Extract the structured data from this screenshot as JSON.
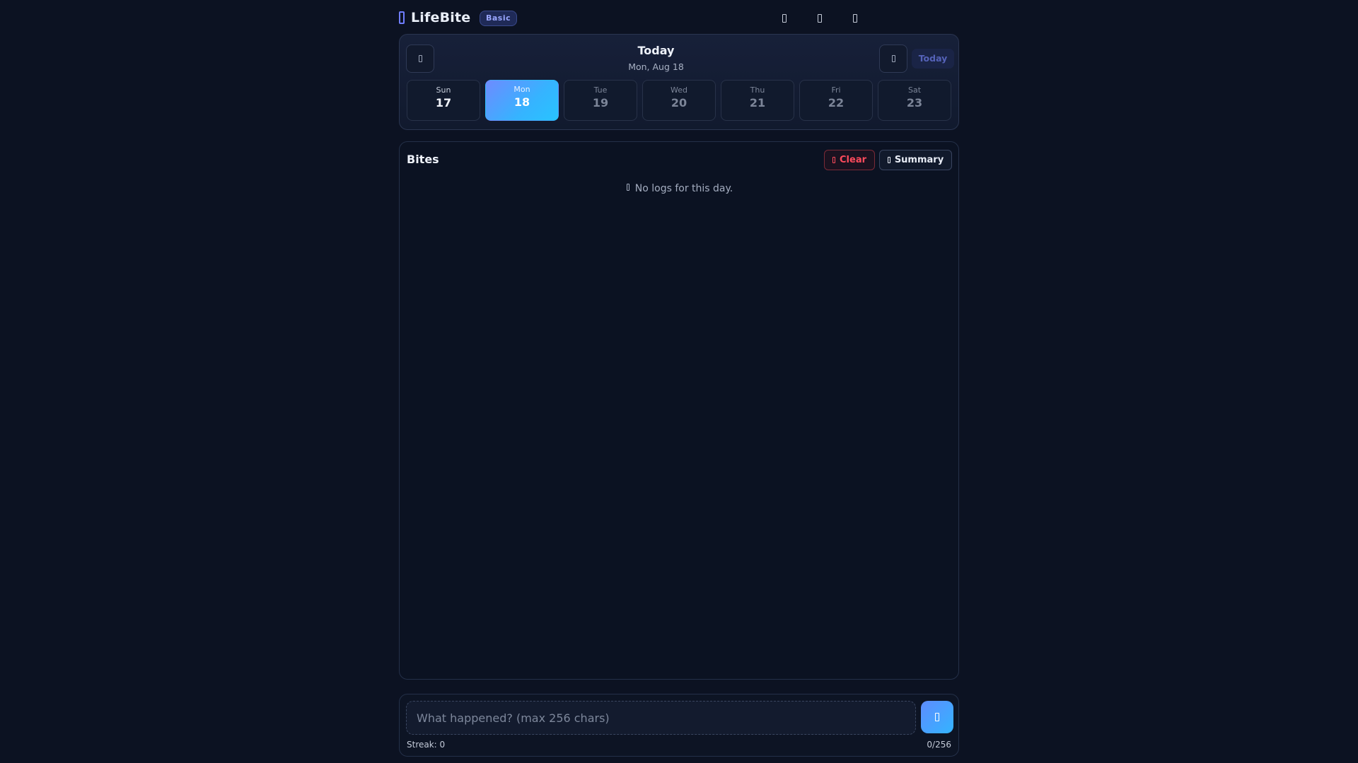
{
  "header": {
    "logo_icon": "book-icon",
    "app_name": "LifeBite",
    "plan_badge": "Basic",
    "actions": [
      {
        "icon": "stats-icon"
      },
      {
        "icon": "theme-icon"
      },
      {
        "icon": "settings-icon"
      }
    ]
  },
  "date_nav": {
    "title": "Today",
    "subtitle": "Mon, Aug 18",
    "prev_icon": "chevron-left-icon",
    "next_icon": "chevron-right-icon",
    "today_label": "Today",
    "week": [
      {
        "day": "Sun",
        "date": "17",
        "state": "past"
      },
      {
        "day": "Mon",
        "date": "18",
        "state": "active"
      },
      {
        "day": "Tue",
        "date": "19",
        "state": "future"
      },
      {
        "day": "Wed",
        "date": "20",
        "state": "future"
      },
      {
        "day": "Thu",
        "date": "21",
        "state": "future"
      },
      {
        "day": "Fri",
        "date": "22",
        "state": "future"
      },
      {
        "day": "Sat",
        "date": "23",
        "state": "future"
      }
    ]
  },
  "bites": {
    "title": "Bites",
    "clear_label": "Clear",
    "clear_icon": "trash-icon",
    "summary_label": "Summary",
    "summary_icon": "document-icon",
    "empty_icon": "info-icon",
    "empty_message": "No logs for this day."
  },
  "composer": {
    "input_value": "",
    "input_placeholder": "What happened? (max 256 chars)",
    "send_icon": "send-icon",
    "streak": "Streak: 0",
    "char_count": "0/256"
  },
  "colors": {
    "background": "#0c1222",
    "accent_start": "#6e8bff",
    "accent_end": "#28c4ff",
    "danger": "#ff4b5c",
    "badge": "#9aa6ff"
  }
}
